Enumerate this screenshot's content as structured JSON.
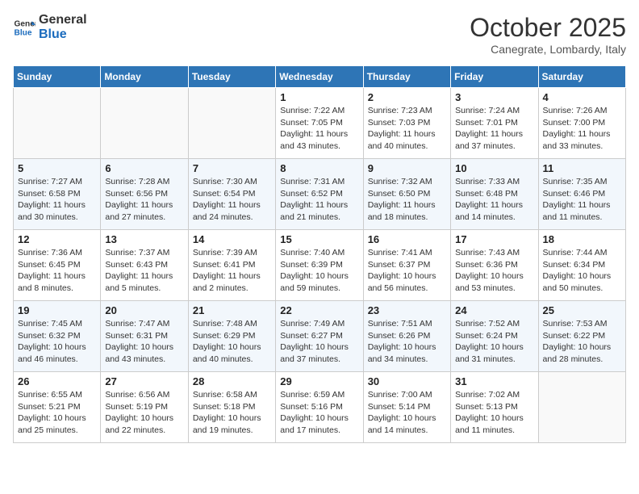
{
  "header": {
    "logo_line1": "General",
    "logo_line2": "Blue",
    "month": "October 2025",
    "location": "Canegrate, Lombardy, Italy"
  },
  "days_of_week": [
    "Sunday",
    "Monday",
    "Tuesday",
    "Wednesday",
    "Thursday",
    "Friday",
    "Saturday"
  ],
  "weeks": [
    [
      {
        "day": "",
        "info": ""
      },
      {
        "day": "",
        "info": ""
      },
      {
        "day": "",
        "info": ""
      },
      {
        "day": "1",
        "info": "Sunrise: 7:22 AM\nSunset: 7:05 PM\nDaylight: 11 hours and 43 minutes."
      },
      {
        "day": "2",
        "info": "Sunrise: 7:23 AM\nSunset: 7:03 PM\nDaylight: 11 hours and 40 minutes."
      },
      {
        "day": "3",
        "info": "Sunrise: 7:24 AM\nSunset: 7:01 PM\nDaylight: 11 hours and 37 minutes."
      },
      {
        "day": "4",
        "info": "Sunrise: 7:26 AM\nSunset: 7:00 PM\nDaylight: 11 hours and 33 minutes."
      }
    ],
    [
      {
        "day": "5",
        "info": "Sunrise: 7:27 AM\nSunset: 6:58 PM\nDaylight: 11 hours and 30 minutes."
      },
      {
        "day": "6",
        "info": "Sunrise: 7:28 AM\nSunset: 6:56 PM\nDaylight: 11 hours and 27 minutes."
      },
      {
        "day": "7",
        "info": "Sunrise: 7:30 AM\nSunset: 6:54 PM\nDaylight: 11 hours and 24 minutes."
      },
      {
        "day": "8",
        "info": "Sunrise: 7:31 AM\nSunset: 6:52 PM\nDaylight: 11 hours and 21 minutes."
      },
      {
        "day": "9",
        "info": "Sunrise: 7:32 AM\nSunset: 6:50 PM\nDaylight: 11 hours and 18 minutes."
      },
      {
        "day": "10",
        "info": "Sunrise: 7:33 AM\nSunset: 6:48 PM\nDaylight: 11 hours and 14 minutes."
      },
      {
        "day": "11",
        "info": "Sunrise: 7:35 AM\nSunset: 6:46 PM\nDaylight: 11 hours and 11 minutes."
      }
    ],
    [
      {
        "day": "12",
        "info": "Sunrise: 7:36 AM\nSunset: 6:45 PM\nDaylight: 11 hours and 8 minutes."
      },
      {
        "day": "13",
        "info": "Sunrise: 7:37 AM\nSunset: 6:43 PM\nDaylight: 11 hours and 5 minutes."
      },
      {
        "day": "14",
        "info": "Sunrise: 7:39 AM\nSunset: 6:41 PM\nDaylight: 11 hours and 2 minutes."
      },
      {
        "day": "15",
        "info": "Sunrise: 7:40 AM\nSunset: 6:39 PM\nDaylight: 10 hours and 59 minutes."
      },
      {
        "day": "16",
        "info": "Sunrise: 7:41 AM\nSunset: 6:37 PM\nDaylight: 10 hours and 56 minutes."
      },
      {
        "day": "17",
        "info": "Sunrise: 7:43 AM\nSunset: 6:36 PM\nDaylight: 10 hours and 53 minutes."
      },
      {
        "day": "18",
        "info": "Sunrise: 7:44 AM\nSunset: 6:34 PM\nDaylight: 10 hours and 50 minutes."
      }
    ],
    [
      {
        "day": "19",
        "info": "Sunrise: 7:45 AM\nSunset: 6:32 PM\nDaylight: 10 hours and 46 minutes."
      },
      {
        "day": "20",
        "info": "Sunrise: 7:47 AM\nSunset: 6:31 PM\nDaylight: 10 hours and 43 minutes."
      },
      {
        "day": "21",
        "info": "Sunrise: 7:48 AM\nSunset: 6:29 PM\nDaylight: 10 hours and 40 minutes."
      },
      {
        "day": "22",
        "info": "Sunrise: 7:49 AM\nSunset: 6:27 PM\nDaylight: 10 hours and 37 minutes."
      },
      {
        "day": "23",
        "info": "Sunrise: 7:51 AM\nSunset: 6:26 PM\nDaylight: 10 hours and 34 minutes."
      },
      {
        "day": "24",
        "info": "Sunrise: 7:52 AM\nSunset: 6:24 PM\nDaylight: 10 hours and 31 minutes."
      },
      {
        "day": "25",
        "info": "Sunrise: 7:53 AM\nSunset: 6:22 PM\nDaylight: 10 hours and 28 minutes."
      }
    ],
    [
      {
        "day": "26",
        "info": "Sunrise: 6:55 AM\nSunset: 5:21 PM\nDaylight: 10 hours and 25 minutes."
      },
      {
        "day": "27",
        "info": "Sunrise: 6:56 AM\nSunset: 5:19 PM\nDaylight: 10 hours and 22 minutes."
      },
      {
        "day": "28",
        "info": "Sunrise: 6:58 AM\nSunset: 5:18 PM\nDaylight: 10 hours and 19 minutes."
      },
      {
        "day": "29",
        "info": "Sunrise: 6:59 AM\nSunset: 5:16 PM\nDaylight: 10 hours and 17 minutes."
      },
      {
        "day": "30",
        "info": "Sunrise: 7:00 AM\nSunset: 5:14 PM\nDaylight: 10 hours and 14 minutes."
      },
      {
        "day": "31",
        "info": "Sunrise: 7:02 AM\nSunset: 5:13 PM\nDaylight: 10 hours and 11 minutes."
      },
      {
        "day": "",
        "info": ""
      }
    ]
  ]
}
